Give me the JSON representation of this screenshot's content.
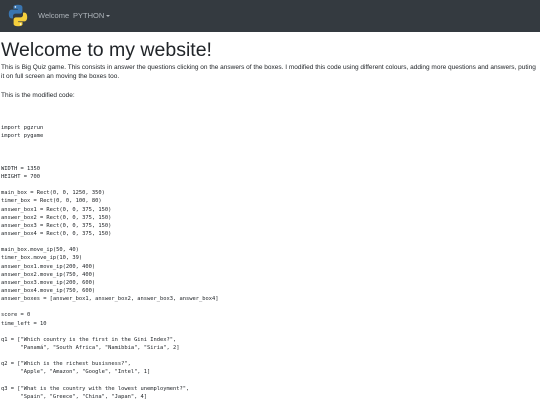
{
  "navbar": {
    "logo_icon": "python-logo-icon",
    "links": [
      {
        "label": "Welcome"
      },
      {
        "label": "PYTHON",
        "has_dropdown": true
      }
    ],
    "colors": {
      "background": "#343a40",
      "link": "#aeb4ba"
    }
  },
  "main": {
    "title": "Welcome to my website!",
    "description": "This is Big Quiz game. This consists in answer the questions clicking on the answers of the boxes. I modified this code using different colours, adding more questions and answers, puting it on full screen an moving the boxes too.",
    "modified_label": "This is the modified code:",
    "code_lines": [
      "",
      "import pgzrun",
      "import pygame",
      "",
      "",
      "",
      "WIDTH = 1350",
      "HEIGHT = 700",
      "",
      "main_box = Rect(0, 0, 1250, 350)",
      "timer_box = Rect(0, 0, 100, 80)",
      "answer_box1 = Rect(0, 0, 375, 150)",
      "answer_box2 = Rect(0, 0, 375, 150)",
      "answer_box3 = Rect(0, 0, 375, 150)",
      "answer_box4 = Rect(0, 0, 375, 150)",
      "",
      "main_box.move_ip(50, 40)",
      "timer_box.move_ip(10, 39)",
      "answer_box1.move_ip(200, 400)",
      "answer_box2.move_ip(750, 400)",
      "answer_box3.move_ip(200, 600)",
      "answer_box4.move_ip(750, 600)",
      "answer_boxes = [answer_box1, answer_box2, answer_box3, answer_box4]",
      "",
      "score = 0",
      "time_left = 10",
      "",
      "q1 = [\"Which country is the first in the Gini Index?\",",
      "      \"Panamá\", \"South Africa\", \"Namibbia\", \"Siria\", 2]",
      "",
      "q2 = [\"Which is the richest busisness?\",",
      "      \"Apple\", \"Amazon\", \"Google\", \"Intel\", 1]",
      "",
      "q3 = [\"What is the country with the lowest unemployment?\",",
      "      \"Spain\", \"Greece\", \"China\", \"Japan\", 4]"
    ]
  }
}
